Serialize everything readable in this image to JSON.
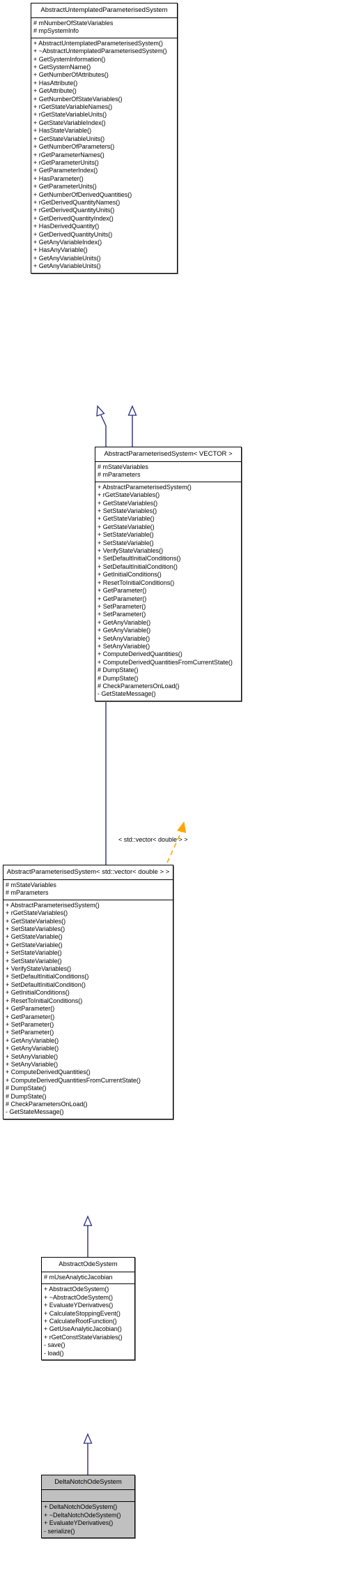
{
  "diagram": {
    "type": "uml-class-inheritance",
    "title": "DeltaNotchOdeSystem inheritance diagram",
    "colors": {
      "box_border": "#000000",
      "box_fill": "#ffffff",
      "highlight_fill": "#c0c0c0",
      "inheritance_line": "#2a2a82",
      "template_binding_line": "#ffa500",
      "text": "#000000",
      "shadow": "#808080"
    },
    "edges": [
      {
        "from": "AbstractParameterisedSystem< VECTOR >",
        "to": "AbstractUntemplatedParameterisedSystem",
        "kind": "inheritance",
        "label": ""
      },
      {
        "from": "AbstractParameterisedSystem< std::vector< double > >",
        "to": "AbstractUntemplatedParameterisedSystem",
        "kind": "inheritance",
        "label": ""
      },
      {
        "from": "AbstractParameterisedSystem< std::vector< double > >",
        "to": "AbstractParameterisedSystem< VECTOR >",
        "kind": "template-binding",
        "label": "< std::vector< double > >"
      },
      {
        "from": "AbstractOdeSystem",
        "to": "AbstractParameterisedSystem< std::vector< double > >",
        "kind": "inheritance",
        "label": ""
      },
      {
        "from": "DeltaNotchOdeSystem",
        "to": "AbstractOdeSystem",
        "kind": "inheritance",
        "label": ""
      }
    ],
    "template_label": "< std::vector< double > >"
  },
  "classes": [
    {
      "id": "abstract-untemplated-parameterised-system",
      "name": "AbstractUntemplatedParameterisedSystem",
      "highlighted": false,
      "attributes": [
        "# mNumberOfStateVariables",
        "# mpSystemInfo"
      ],
      "operations": [
        "+ AbstractUntemplatedParameterisedSystem()",
        "+ ~AbstractUntemplatedParameterisedSystem()",
        "+ GetSystemInformation()",
        "+ GetSystemName()",
        "+ GetNumberOfAttributes()",
        "+ HasAttribute()",
        "+ GetAttribute()",
        "+ GetNumberOfStateVariables()",
        "+ rGetStateVariableNames()",
        "+ rGetStateVariableUnits()",
        "+ GetStateVariableIndex()",
        "+ HasStateVariable()",
        "+ GetStateVariableUnits()",
        "+ GetNumberOfParameters()",
        "+ rGetParameterNames()",
        "+ rGetParameterUnits()",
        "+ GetParameterIndex()",
        "+ HasParameter()",
        "+ GetParameterUnits()",
        "+ GetNumberOfDerivedQuantities()",
        "+ rGetDerivedQuantityNames()",
        "+ rGetDerivedQuantityUnits()",
        "+ GetDerivedQuantityIndex()",
        "+ HasDerivedQuantity()",
        "+ GetDerivedQuantityUnits()",
        "+ GetAnyVariableIndex()",
        "+ HasAnyVariable()",
        "+ GetAnyVariableUnits()",
        "+ GetAnyVariableUnits()"
      ]
    },
    {
      "id": "abstract-parameterised-system-vector",
      "name": "AbstractParameterisedSystem< VECTOR >",
      "highlighted": false,
      "attributes": [
        "# mStateVariables",
        "# mParameters"
      ],
      "operations": [
        "+ AbstractParameterisedSystem()",
        "+ rGetStateVariables()",
        "+ GetStateVariables()",
        "+ SetStateVariables()",
        "+ GetStateVariable()",
        "+ GetStateVariable()",
        "+ SetStateVariable()",
        "+ SetStateVariable()",
        "+ VerifyStateVariables()",
        "+ SetDefaultInitialConditions()",
        "+ SetDefaultInitialCondition()",
        "+ GetInitialConditions()",
        "+ ResetToInitialConditions()",
        "+ GetParameter()",
        "+ GetParameter()",
        "+ SetParameter()",
        "+ SetParameter()",
        "+ GetAnyVariable()",
        "+ GetAnyVariable()",
        "+ SetAnyVariable()",
        "+ SetAnyVariable()",
        "+ ComputeDerivedQuantities()",
        "+ ComputeDerivedQuantitiesFromCurrentState()",
        "# DumpState()",
        "# DumpState()",
        "# CheckParametersOnLoad()",
        "- GetStateMessage()"
      ]
    },
    {
      "id": "abstract-parameterised-system-stdvector-double",
      "name": "AbstractParameterisedSystem< std::vector< double > >",
      "highlighted": false,
      "attributes": [
        "# mStateVariables",
        "# mParameters"
      ],
      "operations": [
        "+ AbstractParameterisedSystem()",
        "+ rGetStateVariables()",
        "+ GetStateVariables()",
        "+ SetStateVariables()",
        "+ GetStateVariable()",
        "+ GetStateVariable()",
        "+ SetStateVariable()",
        "+ SetStateVariable()",
        "+ VerifyStateVariables()",
        "+ SetDefaultInitialConditions()",
        "+ SetDefaultInitialCondition()",
        "+ GetInitialConditions()",
        "+ ResetToInitialConditions()",
        "+ GetParameter()",
        "+ GetParameter()",
        "+ SetParameter()",
        "+ SetParameter()",
        "+ GetAnyVariable()",
        "+ GetAnyVariable()",
        "+ SetAnyVariable()",
        "+ SetAnyVariable()",
        "+ ComputeDerivedQuantities()",
        "+ ComputeDerivedQuantitiesFromCurrentState()",
        "# DumpState()",
        "# DumpState()",
        "# CheckParametersOnLoad()",
        "- GetStateMessage()"
      ]
    },
    {
      "id": "abstract-ode-system",
      "name": "AbstractOdeSystem",
      "highlighted": false,
      "attributes": [
        "# mUseAnalyticJacobian"
      ],
      "operations": [
        "+ AbstractOdeSystem()",
        "+ ~AbstractOdeSystem()",
        "+ EvaluateYDerivatives()",
        "+ CalculateStoppingEvent()",
        "+ CalculateRootFunction()",
        "+ GetUseAnalyticJacobian()",
        "+ rGetConstStateVariables()",
        "- save()",
        "- load()"
      ]
    },
    {
      "id": "delta-notch-ode-system",
      "name": "DeltaNotchOdeSystem",
      "highlighted": true,
      "attributes": [],
      "operations": [
        "+ DeltaNotchOdeSystem()",
        "+ ~DeltaNotchOdeSystem()",
        "+ EvaluateYDerivatives()",
        "- serialize()"
      ]
    }
  ]
}
